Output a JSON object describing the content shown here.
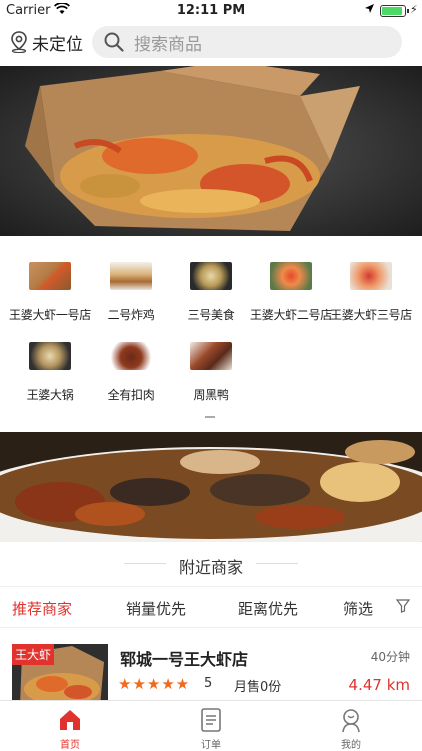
{
  "status_bar": {
    "carrier": "Carrier",
    "time": "12:11 PM",
    "battery_level": 0.9
  },
  "header": {
    "location_label": "未定位",
    "search_placeholder": "搜索商品"
  },
  "categories": [
    {
      "label": "王婆大虾一号店",
      "icon": "crab-box"
    },
    {
      "label": "二号炸鸡",
      "icon": "fried-chicken"
    },
    {
      "label": "三号美食",
      "icon": "platter"
    },
    {
      "label": "王婆大虾二号店",
      "icon": "shrimp-plate"
    },
    {
      "label": "王婆大虾三号店",
      "icon": "shrimp-dish"
    },
    {
      "label": "王婆大锅",
      "icon": "big-pot"
    },
    {
      "label": "全有扣肉",
      "icon": "braised-pork"
    },
    {
      "label": "周黑鸭",
      "icon": "duck"
    }
  ],
  "nearby": {
    "title": "附近商家"
  },
  "sort_tabs": {
    "recommended": "推荐商家",
    "sales": "销量优先",
    "distance": "距离优先",
    "filter": "筛选"
  },
  "shop": {
    "tag": "王大虾",
    "name": "郓城一号王大虾店",
    "delivery_time": "40分钟",
    "stars": "★★★★★",
    "rating": "5",
    "monthly_sales": "月售0份",
    "distance": "4.47 km"
  },
  "tabbar": {
    "home": "首页",
    "orders": "订单",
    "mine": "我的"
  },
  "colors": {
    "accent": "#e0332e",
    "star": "#f06a1e",
    "search_bg": "#eeeeee"
  }
}
